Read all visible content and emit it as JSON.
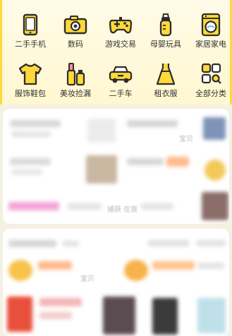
{
  "categories": [
    {
      "label": "二手手机",
      "icon": "phone-icon"
    },
    {
      "label": "数码",
      "icon": "camera-icon"
    },
    {
      "label": "游戏交易",
      "icon": "gamepad-icon"
    },
    {
      "label": "母婴玩具",
      "icon": "baby-bottle-icon"
    },
    {
      "label": "家居家电",
      "icon": "washing-machine-icon"
    },
    {
      "label": "服饰鞋包",
      "icon": "tshirt-icon"
    },
    {
      "label": "美妆捡漏",
      "icon": "cosmetics-icon"
    },
    {
      "label": "二手车",
      "icon": "car-icon"
    },
    {
      "label": "租衣服",
      "icon": "dress-icon"
    },
    {
      "label": "全部分类",
      "icon": "all-categories-icon"
    }
  ],
  "colors": {
    "icon_yellow": "#ffd93a",
    "icon_outline": "#2d2d2d",
    "border_yellow": "#ffd93a"
  },
  "feed": {
    "card1_text_a": "宝贝",
    "card1_text_b": "捕获 在我",
    "card2_text_a": "宝贝"
  }
}
